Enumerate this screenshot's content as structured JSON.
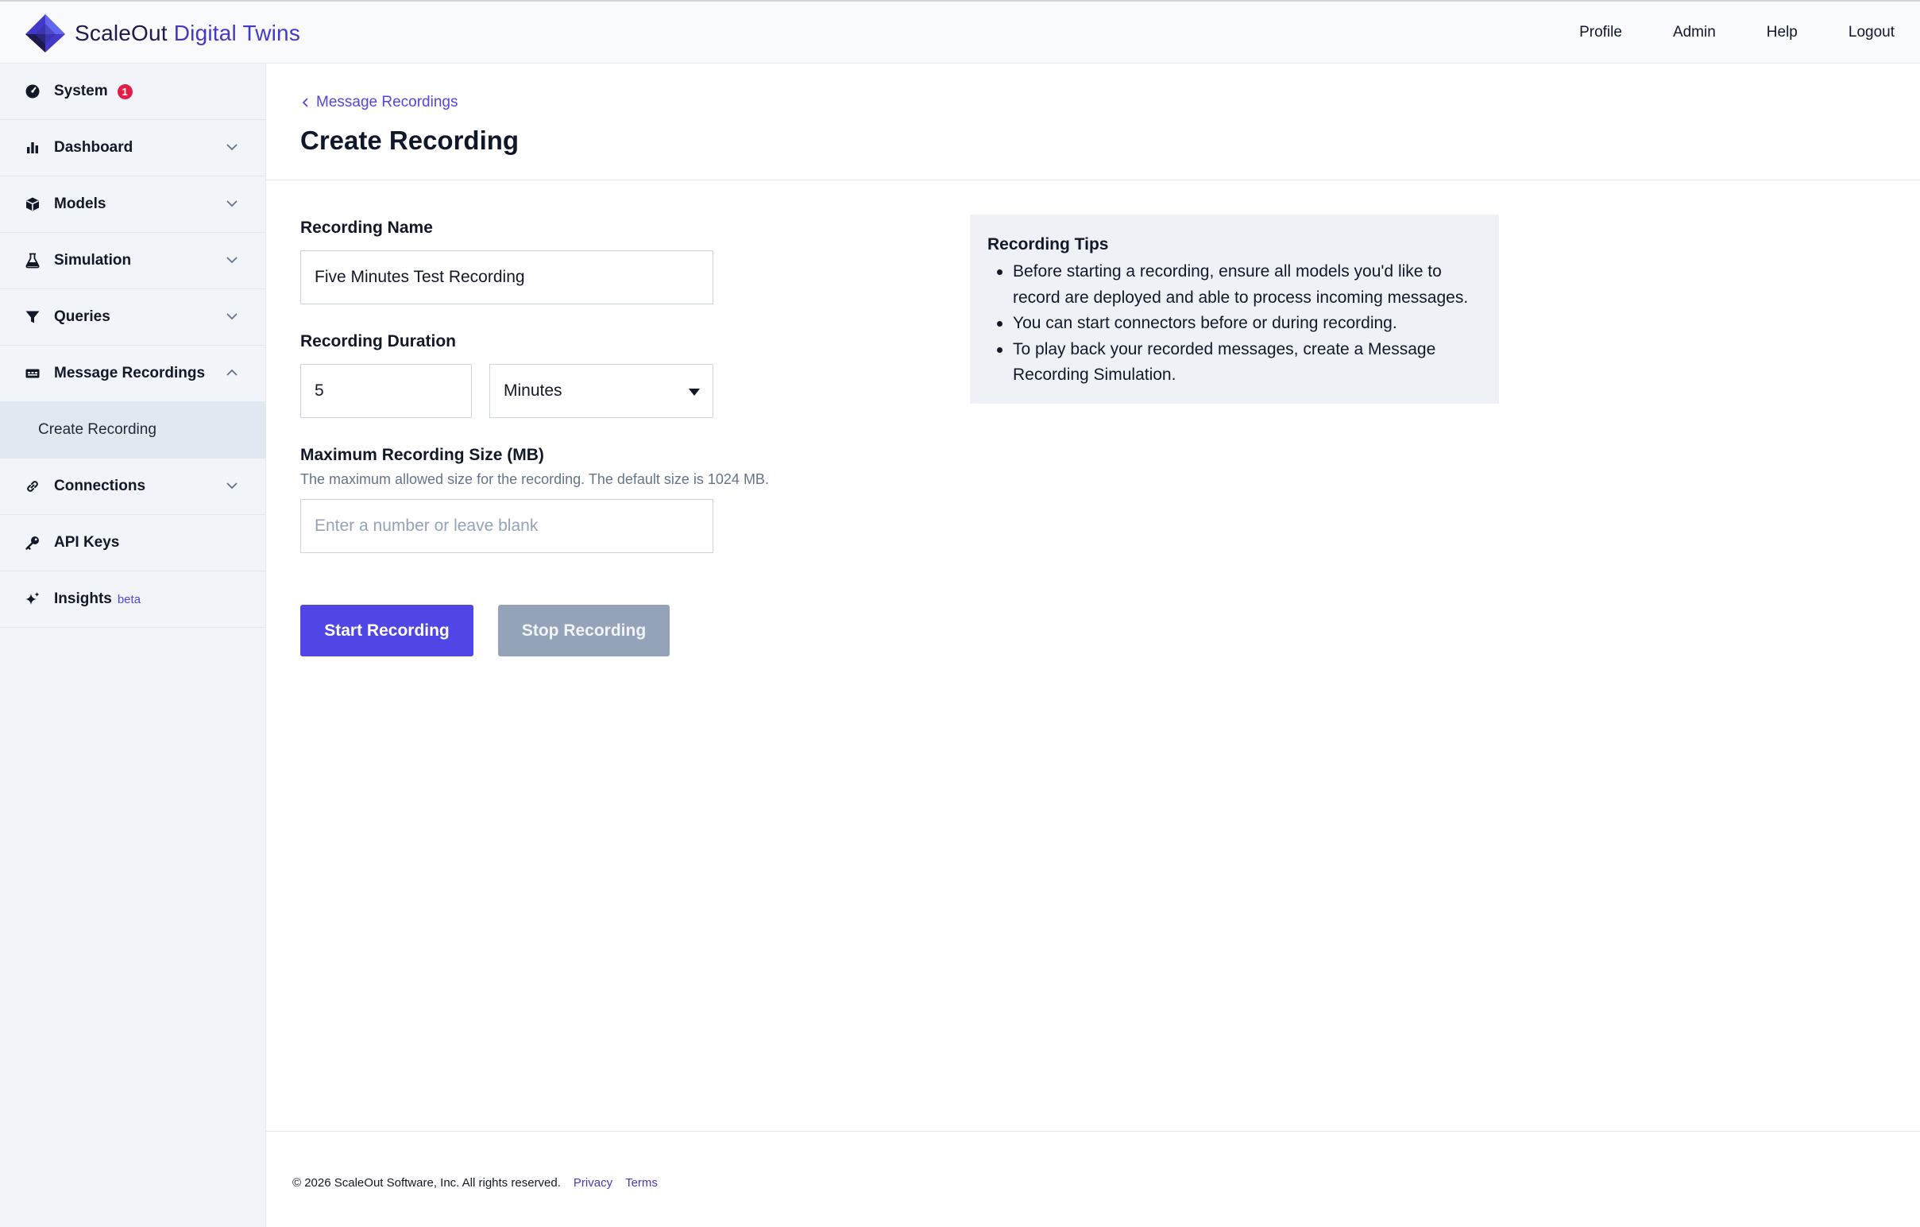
{
  "brand": {
    "name_primary": "ScaleOut",
    "name_secondary": "Digital Twins",
    "logo_icon": "scaleout-logo-icon"
  },
  "topnav": {
    "profile": "Profile",
    "admin": "Admin",
    "help": "Help",
    "logout": "Logout"
  },
  "sidebar": {
    "items": [
      {
        "label": "System",
        "icon": "gauge-icon",
        "badge": "1"
      },
      {
        "label": "Dashboard",
        "icon": "bar-chart-icon"
      },
      {
        "label": "Models",
        "icon": "cube-icon"
      },
      {
        "label": "Simulation",
        "icon": "flask-icon"
      },
      {
        "label": "Queries",
        "icon": "filter-icon"
      },
      {
        "label": "Message Recordings",
        "icon": "recording-icon",
        "expanded": true
      },
      {
        "label": "Connections",
        "icon": "link-icon"
      },
      {
        "label": "API Keys",
        "icon": "key-icon"
      },
      {
        "label": "Insights",
        "icon": "sparkle-icon",
        "tag": "beta"
      }
    ],
    "sub_item": "Create Recording"
  },
  "page": {
    "breadcrumb": "Message Recordings",
    "title": "Create Recording"
  },
  "form": {
    "name_label": "Recording Name",
    "name_value": "Five Minutes Test Recording",
    "duration_label": "Recording Duration",
    "duration_value": "5",
    "duration_unit": "Minutes",
    "size_label": "Maximum Recording Size (MB)",
    "size_help": "The maximum allowed size for the recording. The default size is 1024 MB.",
    "size_placeholder": "Enter a number or leave blank",
    "start_button": "Start Recording",
    "stop_button": "Stop Recording"
  },
  "tips": {
    "title": "Recording Tips",
    "items": [
      "Before starting a recording, ensure all models you'd like to record are deployed and able to process incoming messages.",
      "You can start connectors before or during recording.",
      "To play back your recorded messages, create a Message Recording Simulation."
    ]
  },
  "footer": {
    "copyright": "© 2026 ScaleOut Software, Inc. All rights reserved.",
    "privacy": "Privacy",
    "terms": "Terms"
  },
  "colors": {
    "accent": "#4f46e5",
    "badge": "#e11d48",
    "disabled": "#94a3b8",
    "sidebar_bg": "#f1f4f8"
  }
}
